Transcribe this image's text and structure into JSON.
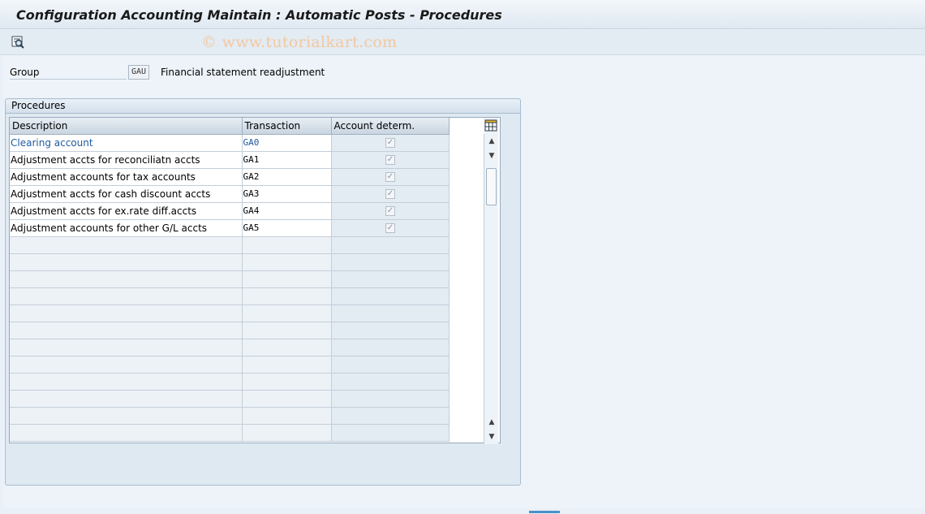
{
  "window": {
    "title": "Configuration Accounting Maintain : Automatic Posts - Procedures"
  },
  "toolbar": {
    "watermark": "© www.tutorialkart.com",
    "buttons": [
      {
        "icon": "display-detail-icon"
      }
    ]
  },
  "header": {
    "group_label": "Group",
    "group_value": "GAU",
    "group_desc": "Financial statement readjustment"
  },
  "procedures": {
    "title": "Procedures",
    "columns": [
      "Description",
      "Transaction",
      "Account determ."
    ],
    "rows": [
      {
        "description": "Clearing account",
        "transaction": "GA0",
        "account_determ": true
      },
      {
        "description": "Adjustment accts for reconciliatn accts",
        "transaction": "GA1",
        "account_determ": true
      },
      {
        "description": "Adjustment accounts for tax accounts",
        "transaction": "GA2",
        "account_determ": true
      },
      {
        "description": "Adjustment accts for cash discount accts",
        "transaction": "GA3",
        "account_determ": true
      },
      {
        "description": "Adjustment accts for ex.rate diff.accts",
        "transaction": "GA4",
        "account_determ": true
      },
      {
        "description": "Adjustment accounts for other G/L accts",
        "transaction": "GA5",
        "account_determ": true
      }
    ],
    "checkmark": "✓"
  },
  "colors": {
    "link": "#1f5a9e",
    "accent": "#4a90c8"
  }
}
